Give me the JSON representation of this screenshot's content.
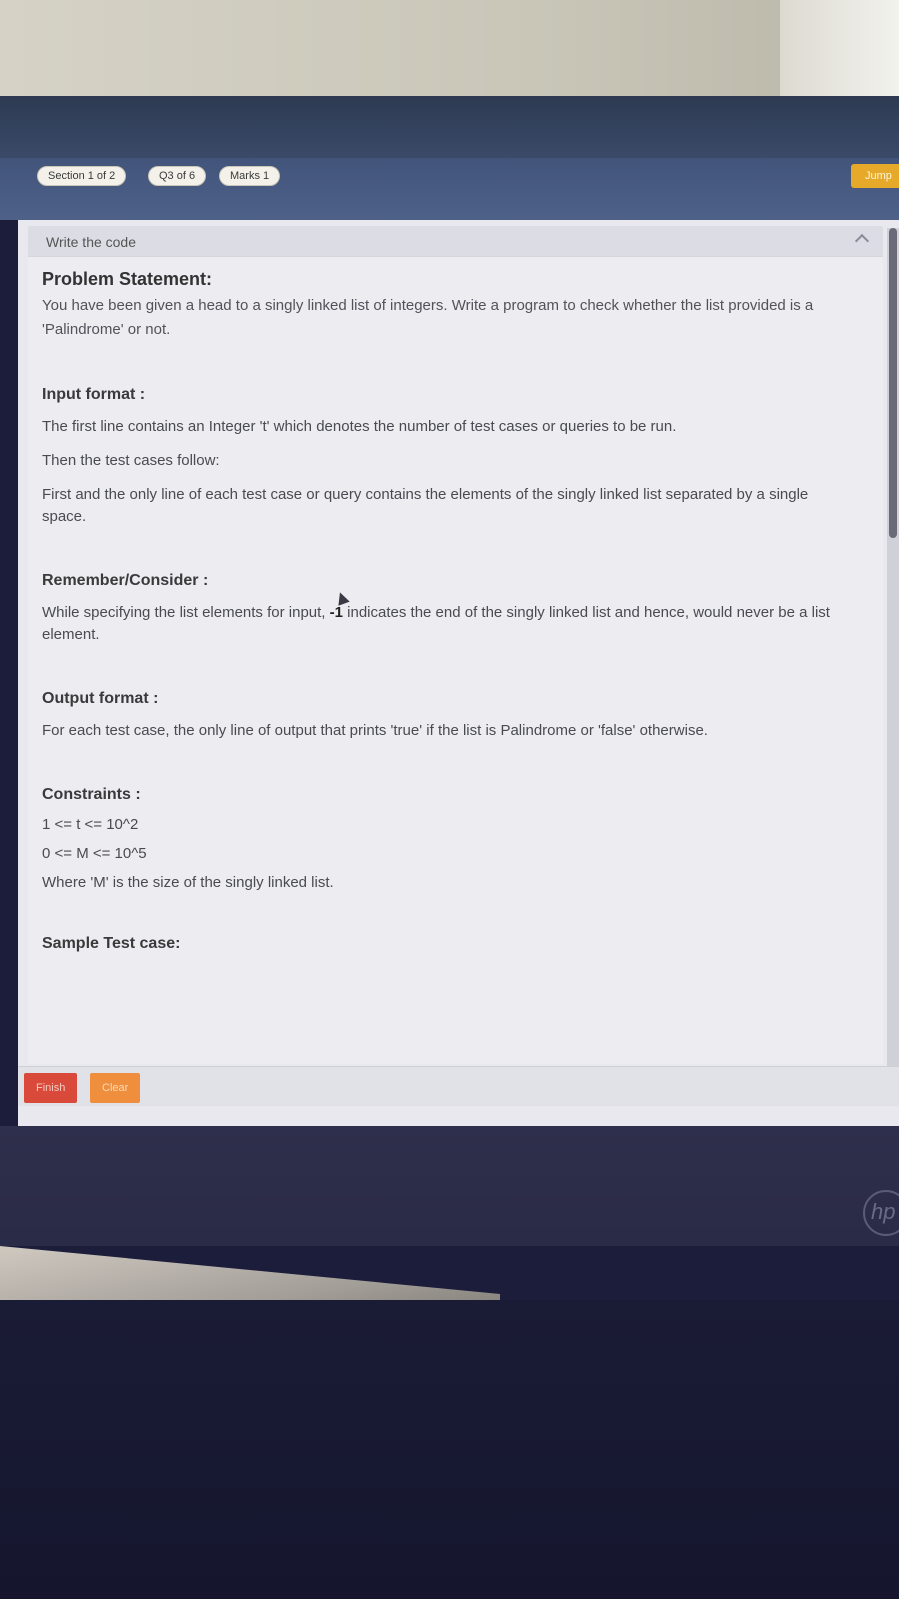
{
  "header": {
    "section_pill": "Section 1 of 2",
    "question_pill": "Q3 of 6",
    "marks_pill": "Marks 1",
    "jump_label": "Jump"
  },
  "question": {
    "label": "Write the code"
  },
  "problem": {
    "title": "Problem Statement:",
    "statement": "You have been given a head to a singly linked list of integers. Write a program to check whether the list provided is a 'Palindrome' or not."
  },
  "input_format": {
    "heading": "Input format :",
    "lines": [
      "The first line contains an Integer 't' which denotes the number of test cases or queries to be run.",
      "Then the test cases follow:",
      "First and the only line of each test case or query contains the elements of the singly linked list separated by a single space."
    ]
  },
  "remember": {
    "heading": "Remember/Consider :",
    "text_before": "While specifying the list elements for input, ",
    "bold": "-1",
    "text_after": " indicates the end of the singly linked list and hence, would never be a list element."
  },
  "output_format": {
    "heading": "Output format :",
    "text": "For each test case, the only line of output that prints 'true' if the list is Palindrome or 'false' otherwise."
  },
  "constraints": {
    "heading": "Constraints :",
    "lines": [
      "1 <= t <= 10^2",
      "0 <= M <= 10^5",
      "Where 'M' is the size of the singly linked list."
    ]
  },
  "sample": {
    "heading": "Sample Test case:"
  },
  "footer": {
    "finish_label": "Finish",
    "clear_label": "Clear"
  },
  "device": {
    "logo_text": "hp"
  },
  "colors": {
    "finish": "#d94a3a",
    "clear": "#ef8f3d",
    "jump": "#e6a92a",
    "header": "#42547a"
  }
}
